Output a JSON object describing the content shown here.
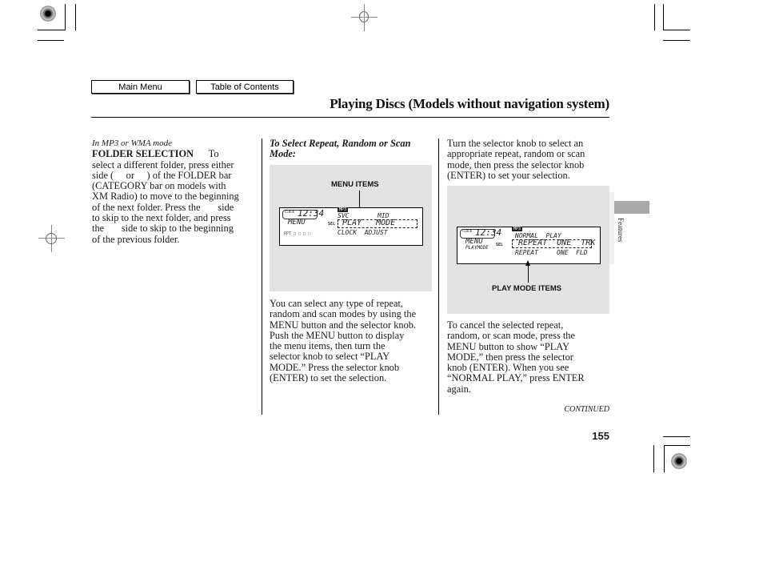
{
  "nav": {
    "main_menu": "Main Menu",
    "table_of_contents": "Table of Contents"
  },
  "header": {
    "title": "Playing Discs (Models without navigation system)"
  },
  "column1": {
    "mode_note": "In MP3 or WMA mode",
    "heading": "FOLDER SELECTION",
    "lines": [
      "To",
      "select a different folder, press either",
      "side (     or     ) of the FOLDER bar",
      "(CATEGORY bar on models with",
      "XM Radio) to move to the beginning",
      "of the next folder. Press the       side",
      "to skip to the next folder, and press",
      "the       side to skip to the beginning",
      "of the previous folder."
    ]
  },
  "column2": {
    "subheading_line1": "To Select Repeat, Random or Scan",
    "subheading_line2": "Mode:",
    "figure": {
      "label": "MENU ITEMS",
      "clock_tag": "CLOCK",
      "clock": "12:34",
      "badge": "MP3",
      "left_label": "MENU",
      "left_sub": "RPT □ □ □ □",
      "sel": "SEL",
      "row1_left": "SVC",
      "row1_right": "MID",
      "row2": "PLAY   MODE",
      "row3": "CLOCK  ADJUST"
    },
    "body": [
      "You can select any type of repeat,",
      "random and scan modes by using the",
      "MENU button and the selector knob.",
      "Push the MENU button to display",
      "the menu items, then turn the",
      "selector knob to select “PLAY",
      "MODE.” Press the selector knob",
      "(ENTER) to set the selection."
    ]
  },
  "column3": {
    "intro": [
      "Turn the selector knob to select an",
      "appropriate repeat, random or scan",
      "mode, then press the selector knob",
      "(ENTER) to set your selection."
    ],
    "figure": {
      "label": "PLAY MODE ITEMS",
      "clock_tag": "CLOCK",
      "clock": "12:34",
      "badge": "MP3",
      "left_label": "MENU",
      "left_sub": "PLAYMODE",
      "sel": "SEL",
      "row1": "NORMAL  PLAY",
      "row2": "REPEAT  ONE  TRK",
      "row3_left": "REPEAT",
      "row3_right": "ONE  FLD"
    },
    "cancel": [
      "To cancel the selected repeat,",
      "random, or scan mode, press the",
      "MENU button to show “PLAY",
      "MODE,” then press the selector",
      "knob (ENTER). When you see",
      "“NORMAL PLAY,” press ENTER",
      "again."
    ],
    "continued": "CONTINUED"
  },
  "side_tab": {
    "label": "Features"
  },
  "footer": {
    "page_number": "155"
  }
}
